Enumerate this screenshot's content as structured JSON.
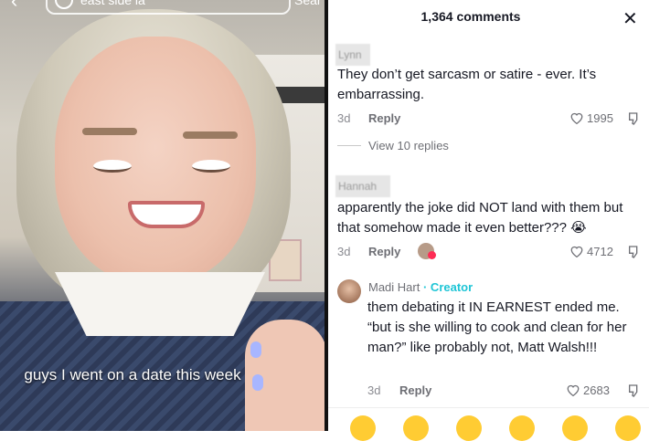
{
  "video": {
    "search_text": "east side la",
    "search_button": "Sear",
    "caption": "guys I went on a date this week"
  },
  "comments_panel": {
    "title": "1,364 comments",
    "close_glyph": "✕",
    "comments": [
      {
        "username": "Lynn",
        "text": "They don’t get sarcasm or satire - ever. It’s embarrassing.",
        "age": "3d",
        "reply_label": "Reply",
        "likes": "1995",
        "view_replies": "View 10 replies"
      },
      {
        "username": "Hannah",
        "text": "apparently the joke did NOT land with them but that somehow made it even better??? 😭",
        "age": "3d",
        "reply_label": "Reply",
        "likes": "4712"
      },
      {
        "username": "Madi Hart",
        "badge": "· Creator",
        "text": "them debating it IN EARNEST ended me. “but is she willing to cook and clean for her man?” like probably not, Matt Walsh!!!",
        "age": "3d",
        "reply_label": "Reply",
        "likes": "2683"
      }
    ]
  },
  "emoji_bar": [
    "😍",
    "😂",
    "😳",
    "😊",
    "😅",
    "🤣"
  ],
  "colors": {
    "text_primary": "#161823",
    "text_secondary": "#8a8b91",
    "creator_accent": "#1ec5d6"
  }
}
